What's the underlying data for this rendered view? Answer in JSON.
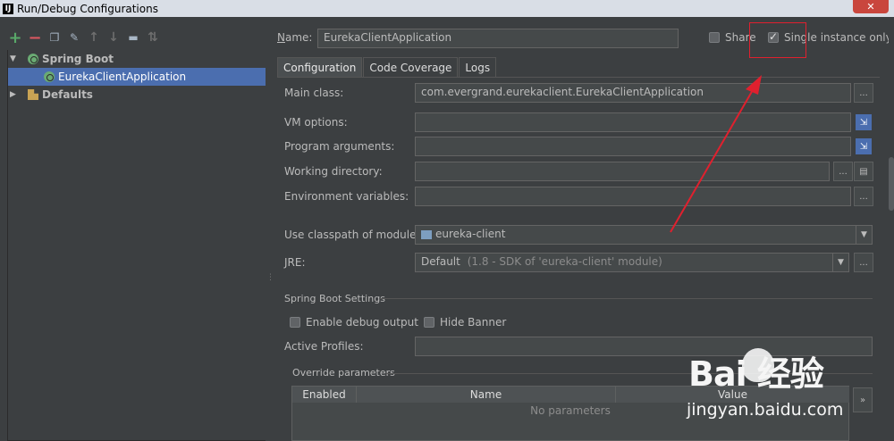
{
  "window": {
    "app_icon": "IJ",
    "title": "Run/Debug Configurations",
    "close_label": "✕"
  },
  "toolbar": {
    "icons": [
      "add-icon",
      "remove-icon",
      "copy-icon",
      "wrench-icon",
      "move-up-icon",
      "move-down-icon",
      "folder-icon",
      "sort-icon"
    ]
  },
  "tree": {
    "spring_boot": "Spring Boot",
    "eureka_app": "EurekaClientApplication",
    "defaults": "Defaults"
  },
  "header": {
    "name_label": "Name:",
    "name_value": "EurekaClientApplication",
    "share_label": "Share",
    "single_instance_label": "Single instance only",
    "share_checked": false,
    "single_instance_checked": true
  },
  "tabs": [
    "Configuration",
    "Code Coverage",
    "Logs"
  ],
  "config": {
    "main_class_label": "Main class:",
    "main_class_value": "com.evergrand.eurekaclient.EurekaClientApplication",
    "vm_options_label": "VM options:",
    "vm_options_value": "",
    "program_args_label": "Program arguments:",
    "program_args_value": "",
    "working_dir_label": "Working directory:",
    "working_dir_value": "",
    "env_vars_label": "Environment variables:",
    "env_vars_value": "",
    "classpath_label": "Use classpath of module:",
    "classpath_value": "eureka-client",
    "jre_label": "JRE:",
    "jre_value": "Default",
    "jre_detail": "(1.8 - SDK of 'eureka-client' module)",
    "ellipsis": "..."
  },
  "spring_boot_settings": {
    "section_label": "Spring Boot Settings",
    "debug_output_label": "Enable debug output",
    "hide_banner_label": "Hide Banner",
    "debug_output_checked": false,
    "hide_banner_checked": false,
    "active_profiles_label": "Active Profiles:",
    "active_profiles_value": ""
  },
  "override": {
    "section_label": "Override parameters",
    "columns": [
      "Enabled",
      "Name",
      "Value"
    ],
    "empty_text": "No parameters",
    "expand_label": "»"
  },
  "watermark": {
    "logo_text": "Bai  经验",
    "url": "jingyan.baidu.com"
  },
  "colors": {
    "background": "#3c3f41",
    "selection": "#4b6eaf",
    "annotation_red": "#e0202e"
  }
}
